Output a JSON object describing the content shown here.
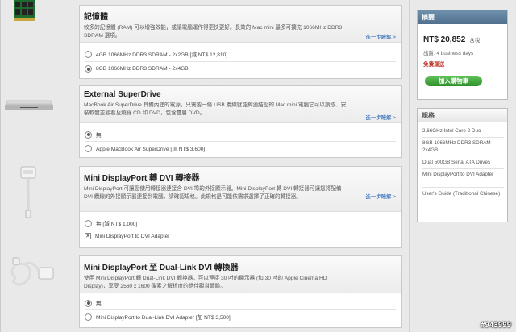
{
  "sections": [
    {
      "title": "記憶體",
      "desc": "較多的記憶體 (RAM) 可以增強效能，或讓電腦運作得更快更好。長效的 Mac mini 最多可擴充 1066MHz DDR3 SDRAM 選項。",
      "learn_more": "進一步瞭解 >",
      "options": [
        {
          "label": "4GB 1066MHz DDR3 SDRAM - 2x2GB [減 NT$ 12,810]",
          "selected": false
        },
        {
          "label": "8GB 1066MHz DDR3 SDRAM - 2x4GB",
          "selected": true
        }
      ]
    },
    {
      "title": "External SuperDrive",
      "desc": "MacBook Air SuperDrive 具備內建的電源，只需要一條 USB 纜線就能夠連結您的 Mac mini 電腦它可以讀取、安裝軟體並觀看及燒錄 CD 和 DVD，包含雙層 DVD。",
      "learn_more": "進一步瞭解 >",
      "options": [
        {
          "label": "無",
          "selected": true
        },
        {
          "label": "Apple MacBook Air SuperDrive [加 NT$ 3,600]",
          "selected": false
        }
      ]
    },
    {
      "title": "Mini DisplayPort 轉 DVI 轉接器",
      "desc": "Mini DisplayPort 可讓您使用轉接器連接含 DVI 埠的外接顯示器。Mini DisplayPort 轉 DVI 轉接器可讓您將配備 DVI 纜線的外接顯示器連接到電腦，請確認規格。此規格是可能依需求選擇了正確的轉接器。",
      "learn_more": "進一步瞭解 >",
      "options": [
        {
          "label": "無 [減 NT$ 1,000]",
          "selected": false
        },
        {
          "label": "Mini DisplayPort to DVI Adapter",
          "selected": true
        }
      ]
    },
    {
      "title": "Mini DisplayPort 至 Dual-Link DVI 轉換器",
      "desc": "使用 Mini DisplayPort 轉 Dual-Link DVI 轉換器，可以連接 30 吋的顯示器 (如 30 吋的 Apple Cinema HD Display)，享受 2560 x 1600 像素之解析度的絕佳觀賞體驗。",
      "learn_more": "",
      "options": [
        {
          "label": "無",
          "selected": true
        },
        {
          "label": "Mini DisplayPort to Dual-Link DVI Adapter [加 NT$ 3,500]",
          "selected": false
        }
      ]
    }
  ],
  "summary": {
    "header": "摘要",
    "price": "NT$ 20,852",
    "price_suffix": "含稅",
    "ships_label": "出貨: 4 business days",
    "free_shipping": "免費運送",
    "add_to_cart": "加入購物車"
  },
  "specs": {
    "header": "規格",
    "items": [
      "2.66GHz Intel Core 2 Duo",
      "8GB 1066MHz DDR3 SDRAM - 2x4GB",
      "Dual 500GB Serial ATA Drives",
      "Mini DisplayPort to DVI Adapter",
      "User's Guide (Traditional Chinese)"
    ]
  },
  "watermark": "#943999"
}
